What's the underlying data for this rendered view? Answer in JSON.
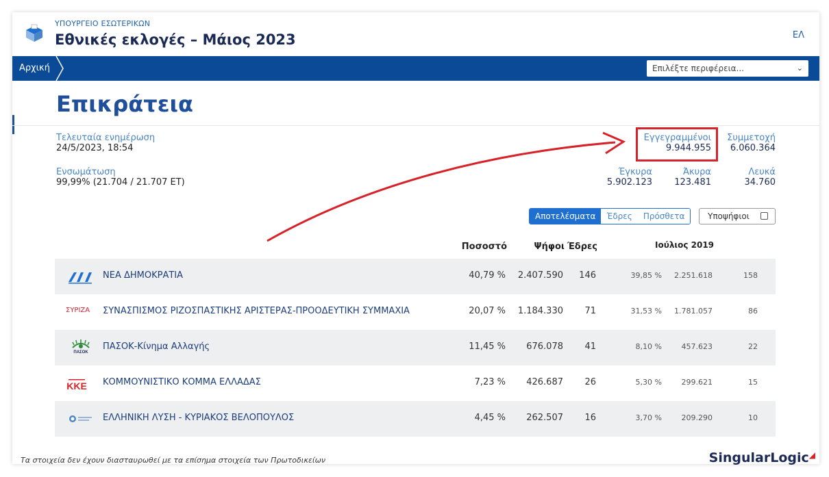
{
  "header": {
    "ministry": "ΥΠΟΥΡΓΕΙΟ ΕΣΩΤΕΡΙΚΩΝ",
    "title": "Εθνικές εκλογές – Μάιος 2023",
    "lang": "ΕΛ"
  },
  "nav": {
    "home": "Αρχική",
    "region_placeholder": "Επιλέξτε περιφέρεια..."
  },
  "page": {
    "title": "Επικράτεια"
  },
  "stats": {
    "last_update_label": "Τελευταία ενημέρωση",
    "last_update_value": "24/5/2023, 18:54",
    "integration_label": "Ενσωμάτωση",
    "integration_value": "99,99% (21.704 / 21.707 ΕΤ)",
    "registered_label": "Εγγεγραμμένοι",
    "registered_value": "9.944.955",
    "turnout_label": "Συμμετοχή",
    "turnout_value": "6.060.364",
    "valid_label": "Έγκυρα",
    "valid_value": "5.902.123",
    "invalid_label": "Άκυρα",
    "invalid_value": "123.481",
    "blank_label": "Λευκά",
    "blank_value": "34.760"
  },
  "tabs": {
    "results": "Αποτελέσματα",
    "seats": "Έδρες",
    "extra": "Πρόσθετα",
    "candidates": "Υποψήφιοι"
  },
  "columns": {
    "percent": "Ποσοστό",
    "votes": "Ψήφοι",
    "seats": "Έδρες",
    "prev": "Ιούλιος 2019"
  },
  "parties": [
    {
      "name": "ΝΕΑ ΔΗΜΟΚΡΑΤΙΑ",
      "pct": "40,79 %",
      "votes": "2.407.590",
      "seats": "146",
      "prev_pct": "39,85 %",
      "prev_votes": "2.251.618",
      "prev_seats": "158",
      "logo": "nd-logo"
    },
    {
      "name": "ΣΥΝΑΣΠΙΣΜΟΣ ΡΙΖΟΣΠΑΣΤΙΚΗΣ ΑΡΙΣΤΕΡΑΣ-ΠΡΟΟΔΕΥΤΙΚΗ ΣΥΜΜΑΧΙΑ",
      "pct": "20,07 %",
      "votes": "1.184.330",
      "seats": "71",
      "prev_pct": "31,53 %",
      "prev_votes": "1.781.057",
      "prev_seats": "86",
      "logo": "syriza-logo",
      "logo_text": "ΣΥΡΙΖΑ"
    },
    {
      "name": "ΠΑΣΟΚ-Κίνημα Αλλαγής",
      "pct": "11,45 %",
      "votes": "676.078",
      "seats": "41",
      "prev_pct": "8,10 %",
      "prev_votes": "457.623",
      "prev_seats": "22",
      "logo": "pasok-logo",
      "logo_text": "ΠΑΣΟΚ"
    },
    {
      "name": "ΚΟΜΜΟΥΝΙΣΤΙΚΟ ΚΟΜΜΑ ΕΛΛΑΔΑΣ",
      "pct": "7,23 %",
      "votes": "426.687",
      "seats": "26",
      "prev_pct": "5,30 %",
      "prev_votes": "299.621",
      "prev_seats": "15",
      "logo": "kke-logo",
      "logo_text": "ΚΚΕ"
    },
    {
      "name": "ΕΛΛΗΝΙΚΗ ΛΥΣΗ - ΚΥΡΙΑΚΟΣ ΒΕΛΟΠΟΥΛΟΣ",
      "pct": "4,45 %",
      "votes": "262.507",
      "seats": "16",
      "prev_pct": "3,70 %",
      "prev_votes": "209.290",
      "prev_seats": "10",
      "logo": "elliniki-lysi-logo"
    }
  ],
  "footer": {
    "note": "Τα στοιχεία δεν έχουν διασταυρωθεί με τα επίσημα στοιχεία των Πρωτοδικείων",
    "brand": "SingularLogic"
  },
  "colors": {
    "nav_blue": "#0b4a97",
    "accent_blue": "#1f6fd1",
    "highlight_red": "#d6232a"
  }
}
